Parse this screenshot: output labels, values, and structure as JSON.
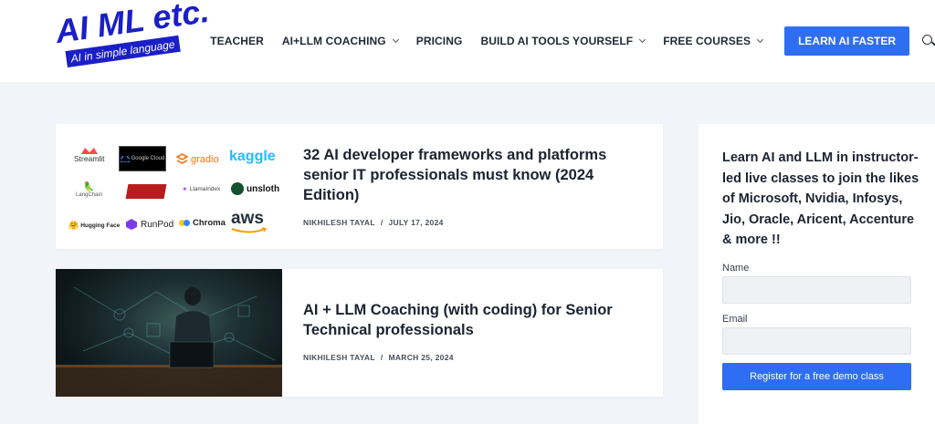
{
  "logo": {
    "title": "AI ML etc.",
    "tagline": "AI in simple language",
    "color": "#1a1fc8"
  },
  "nav": {
    "items": [
      {
        "label": "TEACHER",
        "has_dropdown": false
      },
      {
        "label": "AI+LLM COACHING",
        "has_dropdown": true
      },
      {
        "label": "PRICING",
        "has_dropdown": false
      },
      {
        "label": "BUILD AI TOOLS YOURSELF",
        "has_dropdown": true
      },
      {
        "label": "FREE COURSES",
        "has_dropdown": true
      }
    ],
    "cta": "LEARN AI FASTER",
    "search_icon": "search-icon"
  },
  "colors": {
    "accent": "#2f6ef2",
    "background": "#f1f4f8"
  },
  "posts": [
    {
      "title": "32 AI developer frameworks and platforms senior IT professionals must know (2024 Edition)",
      "author": "NIKHILESH TAYAL",
      "separator": "/",
      "date": "JULY 17, 2024",
      "logos": [
        "Streamlit",
        "Google Cloud",
        "gradio",
        "kaggle",
        "LangChain",
        "",
        "LlamaIndex",
        "unsloth",
        "Hugging Face",
        "RunPod",
        "Chroma",
        "aws"
      ]
    },
    {
      "title": "AI + LLM Coaching (with coding) for Senior Technical professionals",
      "author": "NIKHILESH TAYAL",
      "separator": "/",
      "date": "MARCH 25, 2024"
    }
  ],
  "sidebar": {
    "title": "Learn AI and LLM in instructor-led live classes to join the likes of Microsoft, Nvidia, Infosys, Jio, Oracle, Aricent, Accenture & more !!",
    "name_label": "Name",
    "email_label": "Email",
    "submit_label": "Register for a free demo class"
  }
}
